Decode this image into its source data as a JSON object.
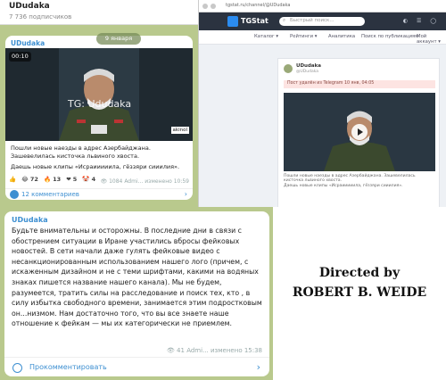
{
  "telegram_top": {
    "channel_title": "UDudaka",
    "subscribers": "7 736 подписчиков",
    "date_pill": "9 января",
    "post": {
      "channel_name": "UDudaka",
      "video_duration": "00:10",
      "watermark": "TG: Ududaka",
      "corner_logo": "akinol",
      "text": "Пошли новые наезды в адрес Азербайджана. Зашевелилась кисточка львиного хвоста.",
      "text2": "Даешь новые клипы «Исраииииилa, гёззяри сииилия».",
      "reactions": [
        {
          "icon": "thumbs-up",
          "count": "🙂"
        },
        {
          "icon": "laugh",
          "count": "72"
        },
        {
          "icon": "fire",
          "count": "13"
        },
        {
          "icon": "heart",
          "count": "5"
        },
        {
          "icon": "clown",
          "count": "4"
        }
      ],
      "views": "1084",
      "author": "Admi...",
      "edited": "изменено 10:59",
      "comments_label": "12 комментариев"
    }
  },
  "telegram_bottom": {
    "channel_name": "UDudaka",
    "body": "Будьте внимательны и осторожны. В последние дни в связи с обострением ситуации в Иране участились вбросы фейковых новостей. В сети начали даже гулять фейковые видео с несанкционированным использованием нашего лого (причем, с искаженным дизайном и не с теми шрифтами, какими на водяных знаках пишется название нашего канала). Мы не будем, разумеется, тратить силы на расследование и поиск тех, кто , в силу избытка свободного времени, занимается этим подростковым он...низмом. Нам достаточно того, что вы все знаете наше отношение к фейкам — мы их категорически не приемлем.",
    "views": "41",
    "author": "Admi...",
    "edited": "изменено 15:38",
    "comment_label": "Прокомментировать"
  },
  "browser": {
    "url": "tgstat.ru/channel/@UDudaka",
    "brand": "TGStat",
    "search_placeholder": "Быстрый поиск...",
    "menu": [
      "Каталог ▾",
      "Рейтинги ▾",
      "Аналитика",
      "Поиск по публикациям",
      "Мой аккаунт ▾"
    ],
    "card": {
      "channel_name": "UDudaka",
      "channel_sub": "@UDudaka",
      "notice": "Пост удалён из Telegram 10 янв, 04:05",
      "caption1": "Пошли новые наезды в адрес Азербайджана. Зашевелилась кисточка львиного хвоста.",
      "caption2": "Даешь новые клипы «Исраииииилa, гёззяри сииилия»."
    }
  },
  "credit": {
    "line1": "Directed by",
    "line2": "ROBERT B. WEIDE"
  },
  "colors": {
    "telegram_bg": "#b9c98d",
    "accent_blue": "#3d8fd1",
    "browser_nav": "#2b3340",
    "notice_bg": "#fde4e2"
  }
}
